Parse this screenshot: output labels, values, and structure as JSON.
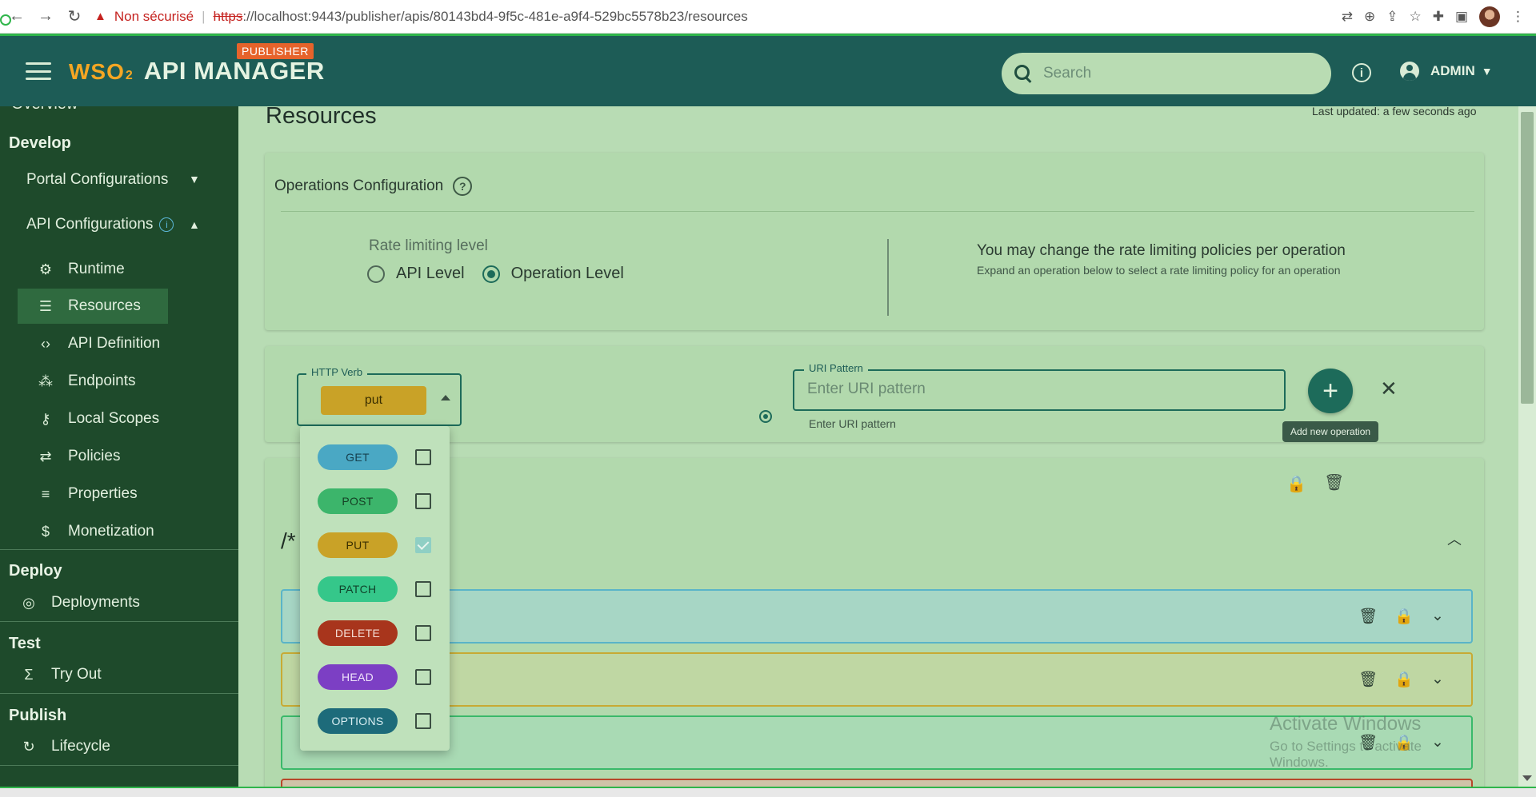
{
  "browser": {
    "insecure_label": "Non sécurisé",
    "url_scheme": "https",
    "url_rest": "://localhost:9443/publisher/apis/80143bd4-9f5c-481e-a9f4-529bc5578b23/resources"
  },
  "header": {
    "product_suffix": "2",
    "logo_text": "WSO",
    "app_name": "API MANAGER",
    "badge": "PUBLISHER",
    "search_placeholder": "Search",
    "user": "ADMIN"
  },
  "sidebar": {
    "overview": "Overview",
    "sections": {
      "develop": "Develop",
      "deploy": "Deploy",
      "test": "Test",
      "publish": "Publish"
    },
    "portal_configurations": "Portal Configurations",
    "api_configurations": "API Configurations",
    "items": [
      {
        "label": "Runtime",
        "icon": "gear-icon"
      },
      {
        "label": "Resources",
        "icon": "resources-icon"
      },
      {
        "label": "API Definition",
        "icon": "code-icon"
      },
      {
        "label": "Endpoints",
        "icon": "endpoints-icon"
      },
      {
        "label": "Local Scopes",
        "icon": "key-icon"
      },
      {
        "label": "Policies",
        "icon": "swap-icon"
      },
      {
        "label": "Properties",
        "icon": "list-icon"
      },
      {
        "label": "Monetization",
        "icon": "dollar-icon"
      }
    ],
    "deployments": "Deployments",
    "try_out": "Try Out",
    "lifecycle": "Lifecycle",
    "active_item": "Resources"
  },
  "main": {
    "title": "Resources",
    "last_updated": "Last updated: a few seconds ago",
    "operations_config": {
      "title": "Operations Configuration",
      "rate_limit_label": "Rate limiting level",
      "options": [
        "API Level",
        "Operation Level"
      ],
      "selected": "Operation Level",
      "message": "You may change the rate limiting policies per operation",
      "sub_message": "Expand an operation below to select a rate limiting policy for an operation"
    },
    "add_operation": {
      "verb_legend": "HTTP Verb",
      "verb_value": "put",
      "uri_legend": "URI Pattern",
      "uri_placeholder": "Enter URI pattern",
      "uri_helper": "Enter URI pattern",
      "tooltip": "Add new operation"
    },
    "resource_path": "/*",
    "watermark_title": "Activate Windows",
    "watermark_sub": "Go to Settings to activate Windows."
  },
  "verb_menu": [
    {
      "label": "GET",
      "color": "#4aa8c4",
      "text": "#163f4d",
      "checked": false
    },
    {
      "label": "POST",
      "color": "#3cb56b",
      "text": "#153f24",
      "checked": false
    },
    {
      "label": "PUT",
      "color": "#c9a227",
      "text": "#3a2f00",
      "checked": true
    },
    {
      "label": "PATCH",
      "color": "#35c78a",
      "text": "#10432b",
      "checked": false
    },
    {
      "label": "DELETE",
      "color": "#a8351c",
      "text": "#f3dcd4",
      "checked": false
    },
    {
      "label": "HEAD",
      "color": "#7c3fc4",
      "text": "#efe3fa",
      "checked": false
    },
    {
      "label": "OPTIONS",
      "color": "#1d6b7a",
      "text": "#d9eef2",
      "checked": false
    }
  ]
}
